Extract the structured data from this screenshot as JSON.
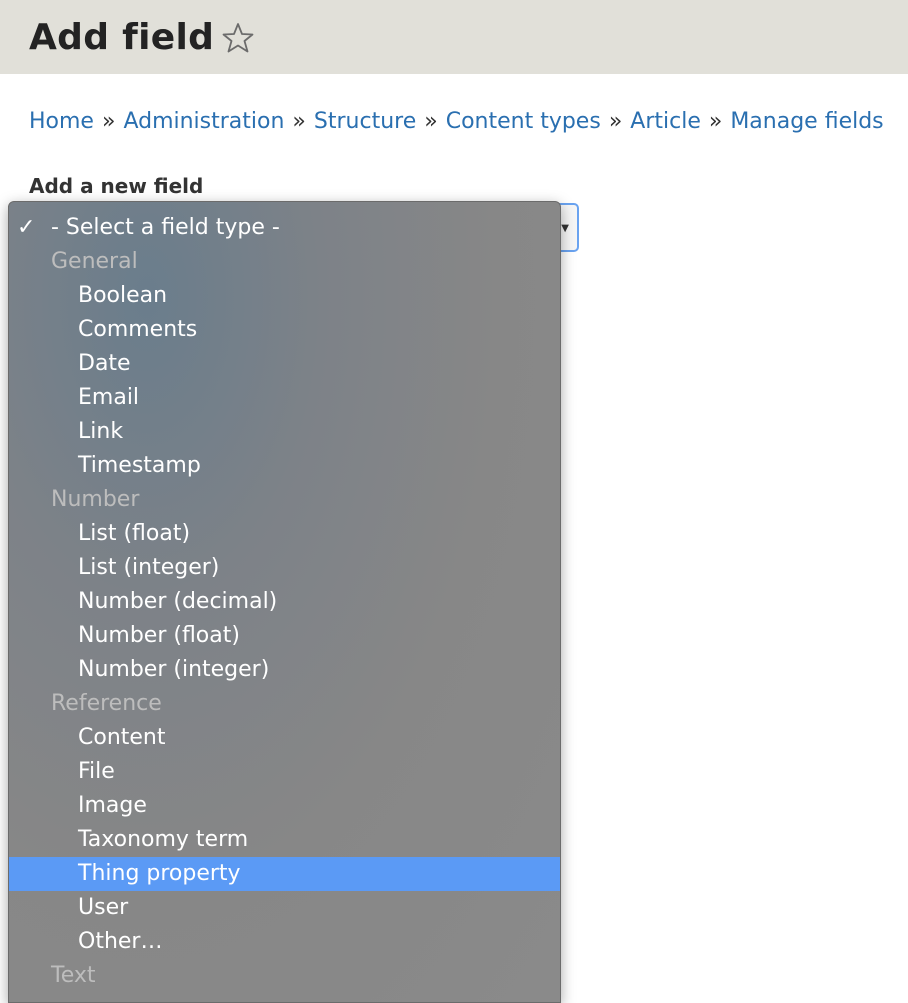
{
  "header": {
    "title": "Add field",
    "star_icon": "star-outline-icon"
  },
  "breadcrumb": {
    "items": [
      "Home",
      "Administration",
      "Structure",
      "Content types",
      "Article",
      "Manage fields"
    ],
    "separator": "»"
  },
  "form": {
    "label": "Add a new field",
    "select": {
      "selected": "- Select a field type -",
      "check_icon": "checkmark-icon",
      "groups": [
        {
          "label": "General",
          "options": [
            "Boolean",
            "Comments",
            "Date",
            "Email",
            "Link",
            "Timestamp"
          ]
        },
        {
          "label": "Number",
          "options": [
            "List (float)",
            "List (integer)",
            "Number (decimal)",
            "Number (float)",
            "Number (integer)"
          ]
        },
        {
          "label": "Reference",
          "options": [
            "Content",
            "File",
            "Image",
            "Taxonomy term",
            "Thing property",
            "User",
            "Other…"
          ]
        },
        {
          "label": "Text",
          "options": []
        }
      ],
      "highlighted": "Thing property"
    }
  },
  "colors": {
    "header_bg": "#e1e0d9",
    "link": "#2a6fb0",
    "highlight": "#5b9af5",
    "focus_border": "#6aa3f0"
  }
}
